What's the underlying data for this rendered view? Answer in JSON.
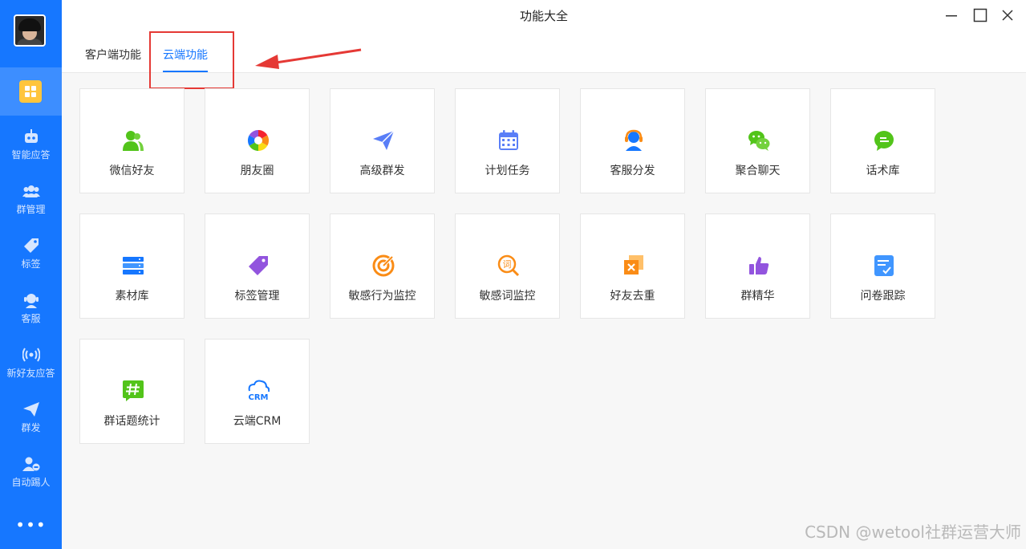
{
  "window": {
    "title": "功能大全"
  },
  "tabs": [
    {
      "label": "客户端功能",
      "active": false
    },
    {
      "label": "云端功能",
      "active": true
    }
  ],
  "sidebar": {
    "items": [
      {
        "label": "智能应答",
        "icon": "robot-icon"
      },
      {
        "label": "群管理",
        "icon": "group-icon"
      },
      {
        "label": "标签",
        "icon": "tag-icon"
      },
      {
        "label": "客服",
        "icon": "headset-icon"
      },
      {
        "label": "新好友应答",
        "icon": "broadcast-icon"
      },
      {
        "label": "群发",
        "icon": "send-icon"
      },
      {
        "label": "自动踢人",
        "icon": "kick-user-icon"
      }
    ],
    "more": "•••"
  },
  "features": [
    {
      "label": "微信好友",
      "icon": "friends-icon",
      "color": "#52c41a"
    },
    {
      "label": "朋友圈",
      "icon": "moments-icon",
      "color": "#fa8c16"
    },
    {
      "label": "高级群发",
      "icon": "paper-plane-icon",
      "color": "#597ef7"
    },
    {
      "label": "计划任务",
      "icon": "calendar-icon",
      "color": "#597ef7"
    },
    {
      "label": "客服分发",
      "icon": "headset-icon",
      "color": "#1677ff"
    },
    {
      "label": "聚合聊天",
      "icon": "wechat-icon",
      "color": "#52c41a"
    },
    {
      "label": "话术库",
      "icon": "chat-bubble-icon",
      "color": "#52c41a"
    },
    {
      "label": "素材库",
      "icon": "server-icon",
      "color": "#1677ff"
    },
    {
      "label": "标签管理",
      "icon": "tag-icon",
      "color": "#9254de"
    },
    {
      "label": "敏感行为监控",
      "icon": "target-icon",
      "color": "#fa8c16"
    },
    {
      "label": "敏感词监控",
      "icon": "word-search-icon",
      "color": "#fa8c16"
    },
    {
      "label": "好友去重",
      "icon": "dedupe-icon",
      "color": "#fa8c16"
    },
    {
      "label": "群精华",
      "icon": "thumbs-up-icon",
      "color": "#9254de"
    },
    {
      "label": "问卷跟踪",
      "icon": "checklist-icon",
      "color": "#1677ff"
    },
    {
      "label": "群话题统计",
      "icon": "hashtag-icon",
      "color": "#52c41a"
    },
    {
      "label": "云端CRM",
      "icon": "cloud-crm-icon",
      "color": "#1677ff"
    }
  ],
  "watermark": "CSDN @wetool社群运营大师"
}
